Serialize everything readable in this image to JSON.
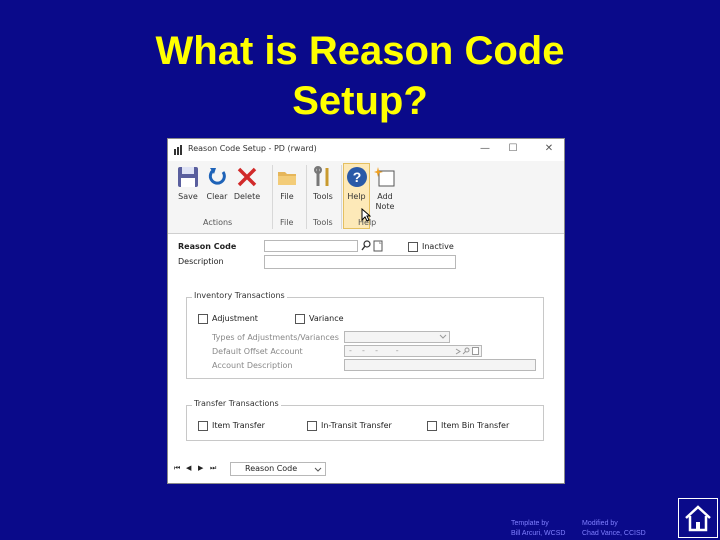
{
  "slide": {
    "title_line1": "What is Reason Code",
    "title_line2": "Setup?"
  },
  "window": {
    "title": "Reason Code Setup  -  PD (rward)",
    "controls": {
      "minimize": "—",
      "maximize": "☐",
      "close": "✕"
    }
  },
  "ribbon": {
    "save": "Save",
    "clear": "Clear",
    "delete": "Delete",
    "file": "File",
    "tools": "Tools",
    "help": "Help",
    "add_note_line1": "Add",
    "add_note_line2": "Note",
    "groups": {
      "actions": "Actions",
      "file": "File",
      "tools": "Tools",
      "help": "Help"
    }
  },
  "form": {
    "reason_code_label": "Reason Code",
    "reason_code_value": "",
    "inactive_label": "Inactive",
    "inactive_checked": false,
    "description_label": "Description",
    "description_value": ""
  },
  "inventory": {
    "title": "Inventory Transactions",
    "adjustment_label": "Adjustment",
    "variance_label": "Variance",
    "types_label": "Types of Adjustments/Variances",
    "types_value": "",
    "default_offset_label": "Default Offset Account",
    "default_offset_value": "-    -    -       -",
    "account_desc_label": "Account Description",
    "account_desc_value": ""
  },
  "transfer": {
    "title": "Transfer Transactions",
    "item_transfer_label": "Item Transfer",
    "in_transit_label": "In-Transit Transfer",
    "item_bin_label": "Item Bin Transfer"
  },
  "navbar": {
    "first": "⏮",
    "prev": "◀",
    "next": "▶",
    "last": "⏭",
    "sort_by": "Reason Code"
  },
  "footer": {
    "template_by": "Template by",
    "template_author": "Bill Arcuri, WCSD",
    "modified_by": "Modified by",
    "modified_author": "Chad Vance, CCISD"
  },
  "colors": {
    "background": "#0a0a8a",
    "title": "#ffff00",
    "help_highlight": "#fde9b8"
  }
}
